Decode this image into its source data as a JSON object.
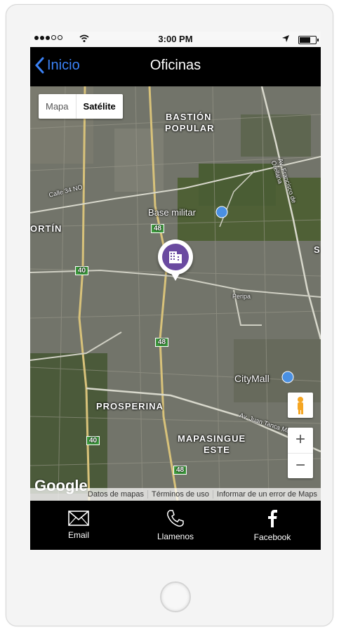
{
  "status_bar": {
    "time": "3:00 PM"
  },
  "nav": {
    "back_label": "Inicio",
    "title": "Oficinas"
  },
  "map": {
    "type_buttons": [
      "Mapa",
      "Satélite"
    ],
    "selected_type": "Satélite",
    "labels": {
      "bastion": "BASTIÓN",
      "popular": "POPULAR",
      "base_militar": "Base militar",
      "fortin": "ORTÍN",
      "prosperina": "PROSPERINA",
      "mapasingue": "MAPASINGUE",
      "este": "ESTE",
      "citymall": "CityMall",
      "s_edge": "S",
      "calle34": "Calle 34 NO",
      "av_francisco": "Av. Francisco de Orellana",
      "av_juan": "Av. Juan Tanca Marengo",
      "peripa": "Peripa",
      "route40a": "40",
      "route40b": "40",
      "route48a": "48",
      "route48b": "48",
      "route48c": "48"
    },
    "google": "Google",
    "attribution": [
      "Datos de mapas",
      "Términos de uso",
      "Informar de un error de Maps"
    ],
    "zoom_in": "+",
    "zoom_out": "−"
  },
  "tabs": [
    {
      "label": "Email",
      "icon": "envelope-icon"
    },
    {
      "label": "Llamenos",
      "icon": "phone-icon"
    },
    {
      "label": "Facebook",
      "icon": "facebook-icon"
    }
  ],
  "colors": {
    "back_accent": "#3b82f6",
    "pin": "#6a4aa0",
    "route_badge": "#3f9e3f"
  }
}
